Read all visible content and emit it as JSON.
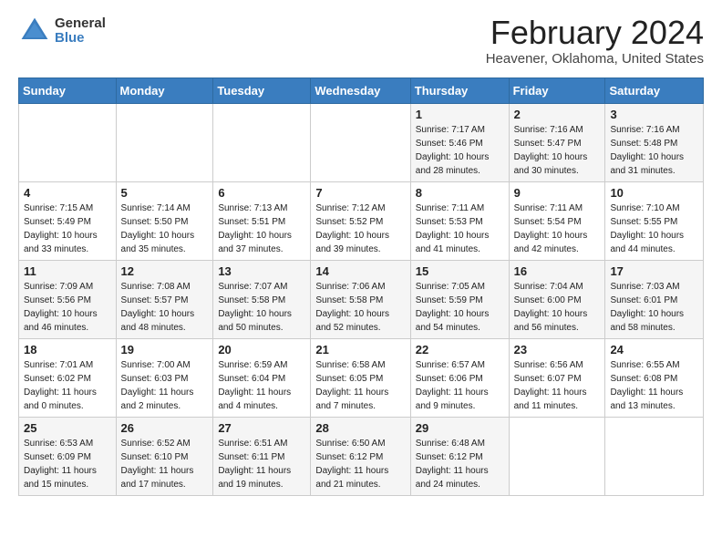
{
  "header": {
    "logo": {
      "general": "General",
      "blue": "Blue"
    },
    "title": "February 2024",
    "location": "Heavener, Oklahoma, United States"
  },
  "weekdays": [
    "Sunday",
    "Monday",
    "Tuesday",
    "Wednesday",
    "Thursday",
    "Friday",
    "Saturday"
  ],
  "weeks": [
    [
      {
        "day": "",
        "info": ""
      },
      {
        "day": "",
        "info": ""
      },
      {
        "day": "",
        "info": ""
      },
      {
        "day": "",
        "info": ""
      },
      {
        "day": "1",
        "info": "Sunrise: 7:17 AM\nSunset: 5:46 PM\nDaylight: 10 hours\nand 28 minutes."
      },
      {
        "day": "2",
        "info": "Sunrise: 7:16 AM\nSunset: 5:47 PM\nDaylight: 10 hours\nand 30 minutes."
      },
      {
        "day": "3",
        "info": "Sunrise: 7:16 AM\nSunset: 5:48 PM\nDaylight: 10 hours\nand 31 minutes."
      }
    ],
    [
      {
        "day": "4",
        "info": "Sunrise: 7:15 AM\nSunset: 5:49 PM\nDaylight: 10 hours\nand 33 minutes."
      },
      {
        "day": "5",
        "info": "Sunrise: 7:14 AM\nSunset: 5:50 PM\nDaylight: 10 hours\nand 35 minutes."
      },
      {
        "day": "6",
        "info": "Sunrise: 7:13 AM\nSunset: 5:51 PM\nDaylight: 10 hours\nand 37 minutes."
      },
      {
        "day": "7",
        "info": "Sunrise: 7:12 AM\nSunset: 5:52 PM\nDaylight: 10 hours\nand 39 minutes."
      },
      {
        "day": "8",
        "info": "Sunrise: 7:11 AM\nSunset: 5:53 PM\nDaylight: 10 hours\nand 41 minutes."
      },
      {
        "day": "9",
        "info": "Sunrise: 7:11 AM\nSunset: 5:54 PM\nDaylight: 10 hours\nand 42 minutes."
      },
      {
        "day": "10",
        "info": "Sunrise: 7:10 AM\nSunset: 5:55 PM\nDaylight: 10 hours\nand 44 minutes."
      }
    ],
    [
      {
        "day": "11",
        "info": "Sunrise: 7:09 AM\nSunset: 5:56 PM\nDaylight: 10 hours\nand 46 minutes."
      },
      {
        "day": "12",
        "info": "Sunrise: 7:08 AM\nSunset: 5:57 PM\nDaylight: 10 hours\nand 48 minutes."
      },
      {
        "day": "13",
        "info": "Sunrise: 7:07 AM\nSunset: 5:58 PM\nDaylight: 10 hours\nand 50 minutes."
      },
      {
        "day": "14",
        "info": "Sunrise: 7:06 AM\nSunset: 5:58 PM\nDaylight: 10 hours\nand 52 minutes."
      },
      {
        "day": "15",
        "info": "Sunrise: 7:05 AM\nSunset: 5:59 PM\nDaylight: 10 hours\nand 54 minutes."
      },
      {
        "day": "16",
        "info": "Sunrise: 7:04 AM\nSunset: 6:00 PM\nDaylight: 10 hours\nand 56 minutes."
      },
      {
        "day": "17",
        "info": "Sunrise: 7:03 AM\nSunset: 6:01 PM\nDaylight: 10 hours\nand 58 minutes."
      }
    ],
    [
      {
        "day": "18",
        "info": "Sunrise: 7:01 AM\nSunset: 6:02 PM\nDaylight: 11 hours\nand 0 minutes."
      },
      {
        "day": "19",
        "info": "Sunrise: 7:00 AM\nSunset: 6:03 PM\nDaylight: 11 hours\nand 2 minutes."
      },
      {
        "day": "20",
        "info": "Sunrise: 6:59 AM\nSunset: 6:04 PM\nDaylight: 11 hours\nand 4 minutes."
      },
      {
        "day": "21",
        "info": "Sunrise: 6:58 AM\nSunset: 6:05 PM\nDaylight: 11 hours\nand 7 minutes."
      },
      {
        "day": "22",
        "info": "Sunrise: 6:57 AM\nSunset: 6:06 PM\nDaylight: 11 hours\nand 9 minutes."
      },
      {
        "day": "23",
        "info": "Sunrise: 6:56 AM\nSunset: 6:07 PM\nDaylight: 11 hours\nand 11 minutes."
      },
      {
        "day": "24",
        "info": "Sunrise: 6:55 AM\nSunset: 6:08 PM\nDaylight: 11 hours\nand 13 minutes."
      }
    ],
    [
      {
        "day": "25",
        "info": "Sunrise: 6:53 AM\nSunset: 6:09 PM\nDaylight: 11 hours\nand 15 minutes."
      },
      {
        "day": "26",
        "info": "Sunrise: 6:52 AM\nSunset: 6:10 PM\nDaylight: 11 hours\nand 17 minutes."
      },
      {
        "day": "27",
        "info": "Sunrise: 6:51 AM\nSunset: 6:11 PM\nDaylight: 11 hours\nand 19 minutes."
      },
      {
        "day": "28",
        "info": "Sunrise: 6:50 AM\nSunset: 6:12 PM\nDaylight: 11 hours\nand 21 minutes."
      },
      {
        "day": "29",
        "info": "Sunrise: 6:48 AM\nSunset: 6:12 PM\nDaylight: 11 hours\nand 24 minutes."
      },
      {
        "day": "",
        "info": ""
      },
      {
        "day": "",
        "info": ""
      }
    ]
  ]
}
